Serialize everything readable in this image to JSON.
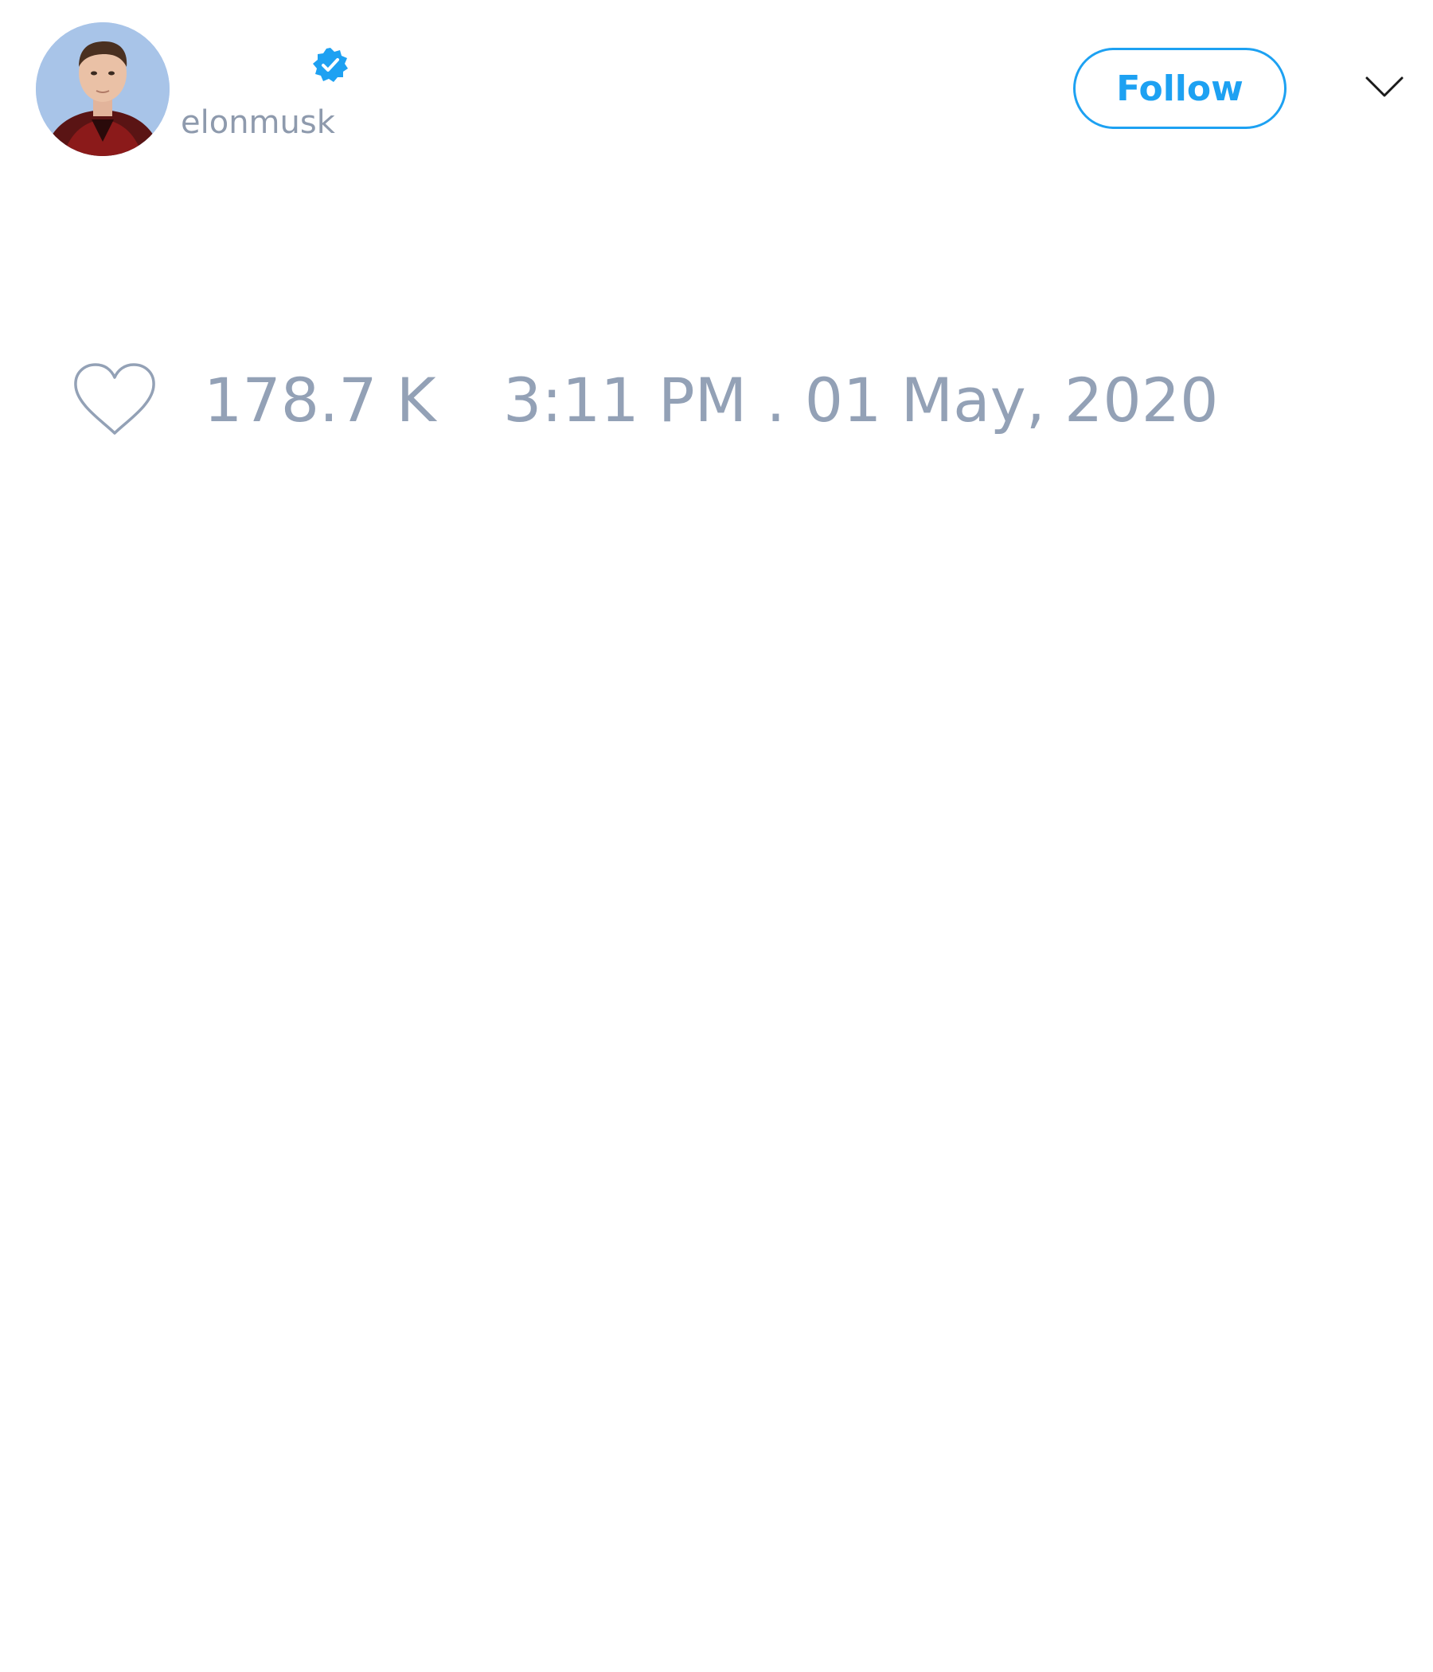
{
  "author": {
    "display_name": "",
    "handle": "elonmusk",
    "verified": true,
    "avatar_icon": "profile-photo"
  },
  "actions": {
    "follow_label": "Follow",
    "menu_icon": "chevron-down-icon"
  },
  "tweet": {
    "like_icon": "heart-outline-icon",
    "like_count": "178.7 K",
    "timestamp": "3:11 PM . 01 May, 2020"
  },
  "colors": {
    "accent": "#1da1f2",
    "muted_text": "#93a1b6",
    "background": "#ffffff"
  }
}
